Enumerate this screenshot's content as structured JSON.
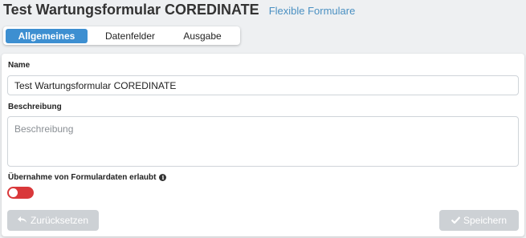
{
  "header": {
    "title": "Test Wartungsformular COREDINATE",
    "subtitle": "Flexible Formulare"
  },
  "tabs": [
    {
      "label": "Allgemeines",
      "active": true
    },
    {
      "label": "Datenfelder",
      "active": false
    },
    {
      "label": "Ausgabe",
      "active": false
    }
  ],
  "form": {
    "name_label": "Name",
    "name_value": "Test Wartungsformular COREDINATE",
    "description_label": "Beschreibung",
    "description_placeholder": "Beschreibung",
    "takeover_label": "Übernahme von Formulardaten erlaubt",
    "takeover_info_icon": "info-icon",
    "takeover_enabled": false
  },
  "buttons": {
    "reset_label": "Zurücksetzen",
    "reset_icon": "undo-arrow-icon",
    "save_label": "Speichern",
    "save_icon": "checkmark-icon"
  },
  "colors": {
    "accent": "#3d8fd1",
    "subtitle": "#4a90c2",
    "toggle_off": "#d9383a",
    "button_disabled": "#cdd1d5"
  }
}
